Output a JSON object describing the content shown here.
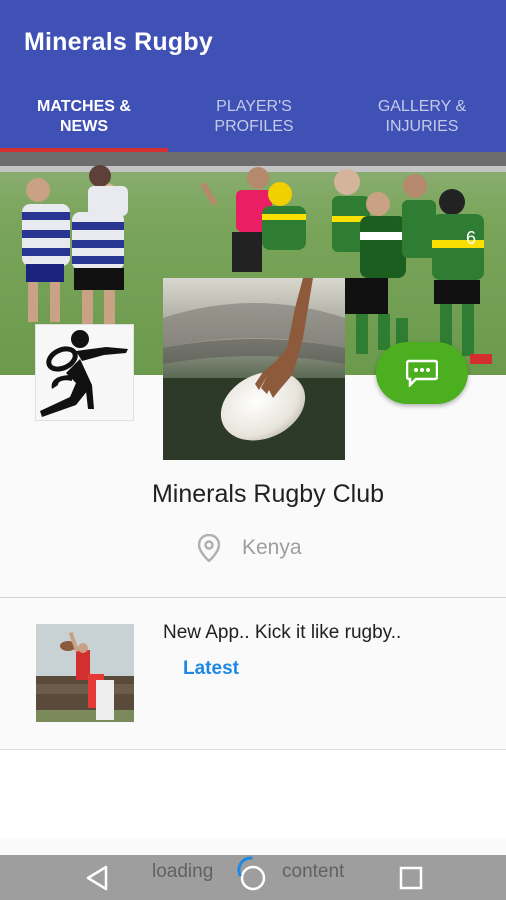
{
  "app": {
    "title": "Minerals Rugby"
  },
  "tabs": [
    {
      "line1": "MATCHES &",
      "line2": "NEWS",
      "active": true
    },
    {
      "line1": "PLAYER'S",
      "line2": "PROFILES",
      "active": false
    },
    {
      "line1": "GALLERY &",
      "line2": "INJURIES",
      "active": false
    }
  ],
  "colors": {
    "app_bar": "#3f51b5",
    "tab_indicator": "#d32f2f",
    "fab": "#4caf20",
    "link": "#1e88e5"
  },
  "club": {
    "name": "Minerals Rugby Club",
    "location": "Kenya"
  },
  "news": [
    {
      "title": "New App.. Kick it like rugby..",
      "tag": "Latest"
    }
  ],
  "loading": {
    "word1": "loading",
    "word2": "content"
  },
  "icons": {
    "fab": "chat-bubble-icon",
    "location": "location-pin-icon",
    "nav": [
      "back-triangle-icon",
      "home-circle-icon",
      "recents-square-icon"
    ]
  }
}
